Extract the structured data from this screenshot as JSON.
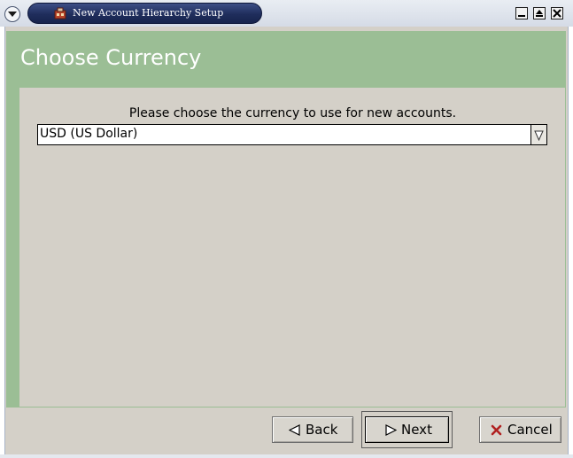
{
  "window": {
    "title": "New Account Hierarchy Setup",
    "title_bar_color": "#1f2d5c",
    "icons": {
      "menu": "chevron-down-icon",
      "app": "gnucash-app-icon",
      "minimize": "minimize-icon",
      "maximize": "maximize-icon",
      "close": "close-icon"
    }
  },
  "page": {
    "heading": "Choose Currency",
    "accent_color": "#9bbe95"
  },
  "currency": {
    "prompt": "Please choose the currency to use for new accounts.",
    "selected": "USD (US Dollar)"
  },
  "buttons": {
    "back": "Back",
    "next": "Next",
    "cancel": "Cancel"
  }
}
